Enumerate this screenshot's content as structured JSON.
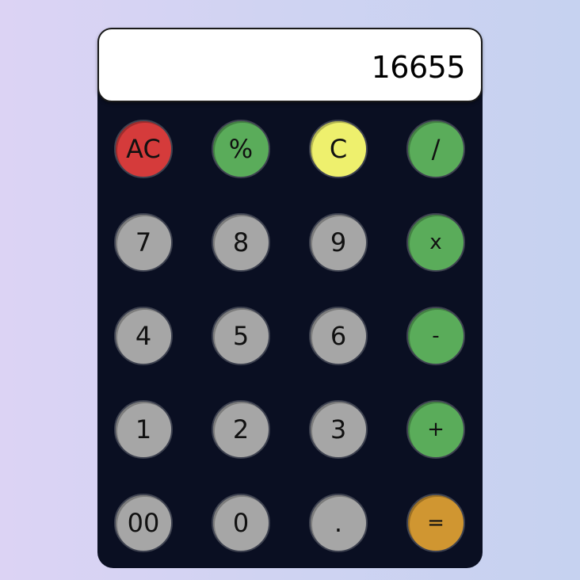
{
  "display": {
    "value": "16655"
  },
  "keys": [
    {
      "label": "AC",
      "name": "clear-all-button",
      "color": "#d53b3b"
    },
    {
      "label": "%",
      "name": "percent-button",
      "color": "#5aac5a"
    },
    {
      "label": "C",
      "name": "clear-button",
      "color": "#eef06d"
    },
    {
      "label": "/",
      "name": "divide-button",
      "color": "#5aac5a"
    },
    {
      "label": "7",
      "name": "digit-7-button",
      "color": "#a6a6a6"
    },
    {
      "label": "8",
      "name": "digit-8-button",
      "color": "#a6a6a6"
    },
    {
      "label": "9",
      "name": "digit-9-button",
      "color": "#a6a6a6"
    },
    {
      "label": "x",
      "name": "multiply-button",
      "color": "#5aac5a"
    },
    {
      "label": "4",
      "name": "digit-4-button",
      "color": "#a6a6a6"
    },
    {
      "label": "5",
      "name": "digit-5-button",
      "color": "#a6a6a6"
    },
    {
      "label": "6",
      "name": "digit-6-button",
      "color": "#a6a6a6"
    },
    {
      "label": "-",
      "name": "subtract-button",
      "color": "#5aac5a"
    },
    {
      "label": "1",
      "name": "digit-1-button",
      "color": "#a6a6a6"
    },
    {
      "label": "2",
      "name": "digit-2-button",
      "color": "#a6a6a6"
    },
    {
      "label": "3",
      "name": "digit-3-button",
      "color": "#a6a6a6"
    },
    {
      "label": "+",
      "name": "add-button",
      "color": "#5aac5a"
    },
    {
      "label": "00",
      "name": "double-zero-button",
      "color": "#a6a6a6"
    },
    {
      "label": "0",
      "name": "digit-0-button",
      "color": "#a6a6a6"
    },
    {
      "label": ".",
      "name": "decimal-point-button",
      "color": "#a6a6a6"
    },
    {
      "label": "=",
      "name": "equals-button",
      "color": "#d09631"
    }
  ]
}
